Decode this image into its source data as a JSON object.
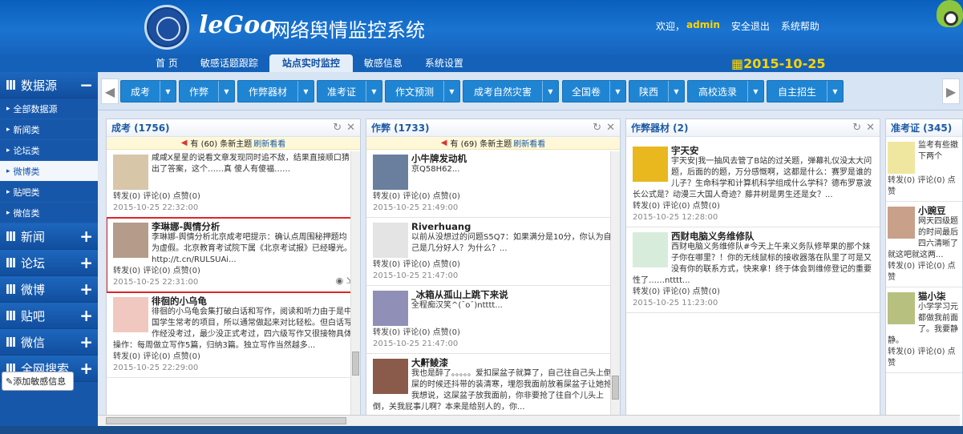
{
  "header": {
    "brand": "leGoo",
    "system_title": "网络舆情监控系统",
    "welcome": "欢迎，",
    "username": "admin",
    "logout": "安全退出",
    "help": "系统帮助",
    "date": "2015-10-25"
  },
  "nav": {
    "tabs": [
      {
        "label": "首 页"
      },
      {
        "label": "敏感话题跟踪"
      },
      {
        "label": "站点实时监控",
        "active": true
      },
      {
        "label": "敏感信息"
      },
      {
        "label": "系统设置"
      }
    ]
  },
  "sidebar": {
    "sections": [
      {
        "label": "数据源",
        "expanded": true,
        "toggle": "−",
        "items": [
          "全部数据源",
          "新闻类",
          "论坛类",
          "微博类",
          "贴吧类",
          "微信类"
        ]
      },
      {
        "label": "新闻",
        "toggle": "+"
      },
      {
        "label": "论坛",
        "toggle": "+"
      },
      {
        "label": "微博",
        "toggle": "+"
      },
      {
        "label": "贴吧",
        "toggle": "+"
      },
      {
        "label": "微信",
        "toggle": "+"
      },
      {
        "label": "全网搜索",
        "toggle": "+"
      }
    ],
    "active_item": "微博类",
    "add_button": "添加敏感信息"
  },
  "filters": [
    "成考",
    "作弊",
    "作弊器材",
    "准考证",
    "作文预测",
    "成考自然灾害",
    "全国卷",
    "陕西",
    "高校选录",
    "自主招生"
  ],
  "columns": [
    {
      "title": "成考 (1756)",
      "new_notice": "有 (60) 条新主题",
      "refresh": "刷新看看",
      "posts": [
        {
          "author": "",
          "text": "咸咸X星星的说看文章发现同时追不敌，结果直接顺口猜出了答案，这个……真 傻人有傻福……",
          "stats": "转发(0) 评论(0) 点赞(0)",
          "time": "2015-10-25 22:32:00"
        },
        {
          "author": "李琳娜-舆情分析",
          "text": "李琳娜-舆情分析北京成考吧提示：确认点周围秘押题均为虚假。北京教育考试院下属《北京考试报》已经曝光。http://t.cn/RULSUAi...",
          "stats": "转发(0) 评论(0) 点赞(0)",
          "time": "2015-10-25 22:31:00",
          "highlight": true
        },
        {
          "author": "徘徊的小乌龟",
          "text": "徘徊的小乌龟会集打破白话和写作，阅读和听力由于是中国学生常考的项目，所以通常做起来对比轻松。但白话写作经没考过，最少没正式考过，四六级写作又很接物具体操作：每周做立写作5篇，归纳3篇。独立写作当然越多...",
          "stats": "转发(0) 评论(0) 点赞(0)",
          "time": "2015-10-25 22:29:00"
        }
      ]
    },
    {
      "title": "作弊 (1733)",
      "new_notice": "有 (69) 条新主题",
      "refresh": "刷新看看",
      "posts": [
        {
          "author": "小牛牌发动机",
          "text": "京Q58H62...",
          "stats": "转发(0) 评论(0) 点赞(0)",
          "time": "2015-10-25 21:49:00"
        },
        {
          "author": "Riverhuang",
          "text": "以前从没想过的问题S5Q7：如果满分是10分，你认为自己是几分好人？为什么？...",
          "stats": "转发(0) 评论(0) 点赞(0)",
          "time": "2015-10-25 21:47:00"
        },
        {
          "author": "_冰箱从孤山上跳下来说",
          "text": "全程痴汉笑^(¯o¯)ntttt...",
          "stats": "转发(0) 评论(0) 点赞(0)",
          "time": "2015-10-25 21:47:00"
        },
        {
          "author": "大鼾鲮漆",
          "text": "我也是醉了。。。。。爱扣屎盆子就算了，自己往自己头上倒屎的时候还抖带的装清寒，埋怨我面前放着屎盆子让她抢我想说，这屎盆子放我面前，你非要抢了往自个儿头上倒，关我屁事儿啊？本来是给别人的，你...",
          "stats": "",
          "time": ""
        }
      ]
    },
    {
      "title": "作弊器材 (2)",
      "posts": [
        {
          "author": "宇天安",
          "text": "宇天安|我一抽风去管了B站的过关题，弹幕礼仪没太大问题，后面的的题，万分感慨啊，这都是什么：赛罗是谁的儿子？生命科学和计算机科学组成什么学科？德布罗意波长公式是？动漫三大国人奇迹？藤井树是男生还是女？...",
          "stats": "转发(0) 评论(0) 点赞(0)",
          "time": "2015-10-25 12:28:00"
        },
        {
          "author": "西财电脑义务维修队",
          "text": "西财电脑义务维修队#今天上午来义务队修苹果的那个妹子你在哪里？！你的无线鼠标的接收器落在队里了可是又没有你的联系方式，快来拿！终于体会到维修登记的重要性了……ntttt...",
          "stats": "转发(0) 评论(0) 点赞(0)",
          "time": "2015-10-25 11:23:00"
        }
      ]
    },
    {
      "title": "准考证 (345)",
      "posts": [
        {
          "author": "",
          "text": "监考有些撤下两个",
          "stats": "转发(0) 评论(0) 点赞",
          "time": ""
        },
        {
          "author": "小豌豆",
          "text": "网天四级题的时间最后四六清晰了就这吧就这两...",
          "stats": "转发(0) 评论(0) 点赞",
          "time": ""
        },
        {
          "author": "猫小柒",
          "text": "小学学习元都做我前面了。我要静静。",
          "stats": "转发(0) 评论(0) 点赞",
          "time": ""
        }
      ]
    }
  ]
}
